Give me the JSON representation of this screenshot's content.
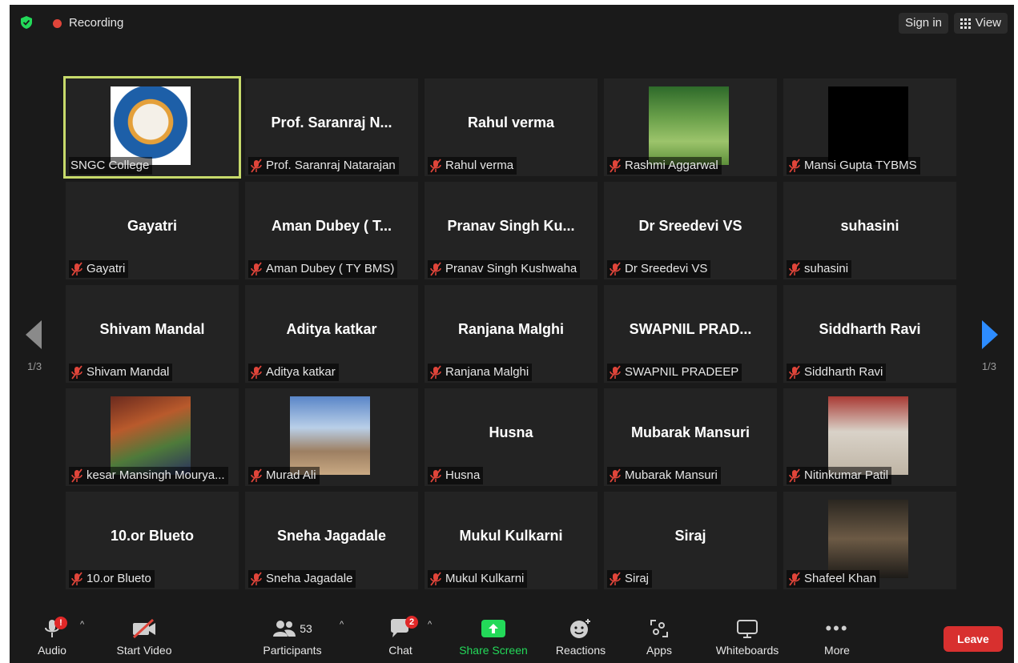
{
  "header": {
    "recording_label": "Recording",
    "signin_label": "Sign in",
    "view_label": "View"
  },
  "pagination": {
    "left_page": "1/3",
    "right_page": "1/3"
  },
  "participants": [
    {
      "display": "",
      "label": "SNGC College",
      "has_photo": true,
      "muted": false
    },
    {
      "display": "Prof. Saranraj N...",
      "label": "Prof. Saranraj Natarajan",
      "has_photo": false,
      "muted": true
    },
    {
      "display": "Rahul verma",
      "label": "Rahul verma",
      "has_photo": false,
      "muted": true
    },
    {
      "display": "",
      "label": "Rashmi Aggarwal",
      "has_photo": true,
      "muted": true
    },
    {
      "display": "",
      "label": "Mansi Gupta TYBMS",
      "has_photo": true,
      "muted": true
    },
    {
      "display": "Gayatri",
      "label": "Gayatri",
      "has_photo": false,
      "muted": true
    },
    {
      "display": "Aman Dubey ( T...",
      "label": "Aman Dubey ( TY BMS)",
      "has_photo": false,
      "muted": true
    },
    {
      "display": "Pranav Singh Ku...",
      "label": "Pranav Singh Kushwaha",
      "has_photo": false,
      "muted": true
    },
    {
      "display": "Dr Sreedevi VS",
      "label": "Dr Sreedevi VS",
      "has_photo": false,
      "muted": true
    },
    {
      "display": "suhasini",
      "label": "suhasini",
      "has_photo": false,
      "muted": true
    },
    {
      "display": "Shivam Mandal",
      "label": "Shivam Mandal",
      "has_photo": false,
      "muted": true
    },
    {
      "display": "Aditya katkar",
      "label": "Aditya katkar",
      "has_photo": false,
      "muted": true
    },
    {
      "display": "Ranjana Malghi",
      "label": "Ranjana Malghi",
      "has_photo": false,
      "muted": true
    },
    {
      "display": "SWAPNIL PRAD...",
      "label": "SWAPNIL PRADEEP",
      "has_photo": false,
      "muted": true
    },
    {
      "display": "Siddharth Ravi",
      "label": "Siddharth Ravi",
      "has_photo": false,
      "muted": true
    },
    {
      "display": "",
      "label": "kesar Mansingh Mourya...",
      "has_photo": true,
      "muted": true
    },
    {
      "display": "",
      "label": "Murad Ali",
      "has_photo": true,
      "muted": true
    },
    {
      "display": "Husna",
      "label": "Husna",
      "has_photo": false,
      "muted": true
    },
    {
      "display": "Mubarak Mansuri",
      "label": "Mubarak Mansuri",
      "has_photo": false,
      "muted": true
    },
    {
      "display": "",
      "label": "Nitinkumar Patil",
      "has_photo": true,
      "muted": true
    },
    {
      "display": "10.or Blueto",
      "label": "10.or Blueto",
      "has_photo": false,
      "muted": true
    },
    {
      "display": "Sneha Jagadale",
      "label": "Sneha Jagadale",
      "has_photo": false,
      "muted": true
    },
    {
      "display": "Mukul Kulkarni",
      "label": "Mukul Kulkarni",
      "has_photo": false,
      "muted": true
    },
    {
      "display": "Siraj",
      "label": "Siraj",
      "has_photo": false,
      "muted": true
    },
    {
      "display": "",
      "label": "Shafeel Khan",
      "has_photo": true,
      "muted": true
    }
  ],
  "toolbar": {
    "audio_label": "Audio",
    "audio_badge": "!",
    "video_label": "Start Video",
    "participants_label": "Participants",
    "participants_count": "53",
    "chat_label": "Chat",
    "chat_badge": "2",
    "share_label": "Share Screen",
    "reactions_label": "Reactions",
    "apps_label": "Apps",
    "whiteboards_label": "Whiteboards",
    "more_label": "More",
    "leave_label": "Leave"
  },
  "colors": {
    "background": "#1a1a1a",
    "tile": "#232323",
    "active_speaker": "#c7da6b",
    "accent_blue": "#2d8cff",
    "share_green": "#23d959",
    "leave_red": "#d8302f",
    "muted_red": "#e0453a"
  }
}
